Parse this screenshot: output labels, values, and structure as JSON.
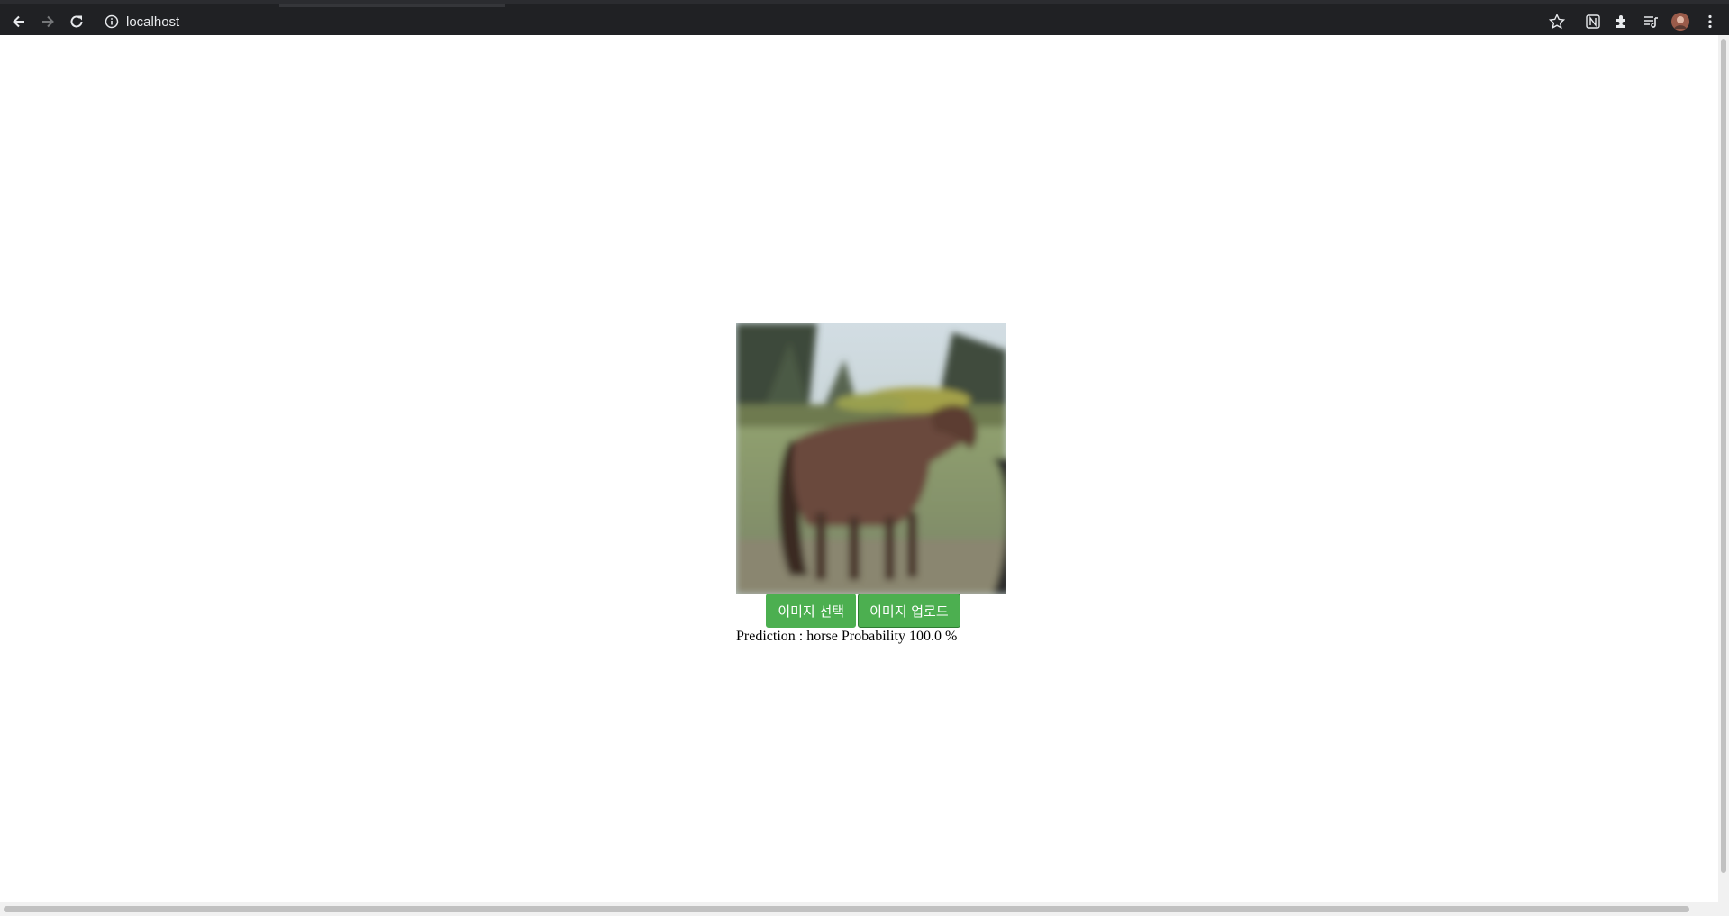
{
  "browser": {
    "url": "localhost",
    "icons": [
      "back-icon",
      "forward-icon",
      "reload-icon",
      "info-icon",
      "star-icon",
      "notion-icon",
      "extensions-icon",
      "reading-list-icon",
      "profile-avatar",
      "menu-icon"
    ]
  },
  "page": {
    "buttons": {
      "select_label": "이미지 선택",
      "upload_label": "이미지 업로드"
    },
    "result_text": "Prediction : horse Probability 100.0 %"
  },
  "colors": {
    "button_bg": "#4caf50",
    "toolbar_bg": "#202124"
  }
}
